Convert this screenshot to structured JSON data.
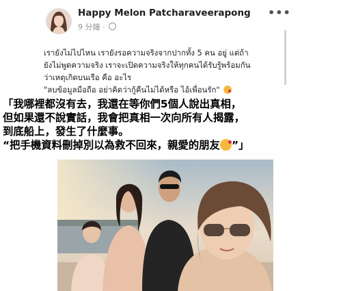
{
  "post": {
    "author": "Happy Melon Patcharaveerapong",
    "timestamp": "9 分鐘",
    "more_label": "•••",
    "caption_lines": [
      "เรายังไม่ไปไหน เรายังรอความจริงจากปากทั้ง 5 คน อยู่ แต่ถ้า",
      "ยังไม่พูดความจริง เราจะเปิดความจริงให้ทุกคนได้รับรู้พร้อมกัน",
      "ว่าเหตุเกิดบนเรือ คือ อะไร",
      "\"ลบข้อมูลมือถือ อย่าคิดว่ากู้คืนไม่ได้หรือ ไอ้เพื่อนรัก\""
    ],
    "caption_emoji": "winking-kiss-emoji"
  },
  "translation": {
    "lines": [
      "「我哪裡都沒有去，我還在等你們5個人說出真相，",
      "但如果還不說實話，我會把真相一次向所有人揭露，",
      "到底船上，發生了什麼事。",
      "“把手機資料刪掉別以為救不回來，親愛的朋友",
      "”」"
    ],
    "emoji": "kiss-emoji"
  },
  "colors": {
    "author_text": "#1c1e21",
    "meta_text": "#90949c",
    "sky_top": "#a9bcc8",
    "sky_bottom": "#e9dccb",
    "water": "#9aa5a9"
  }
}
